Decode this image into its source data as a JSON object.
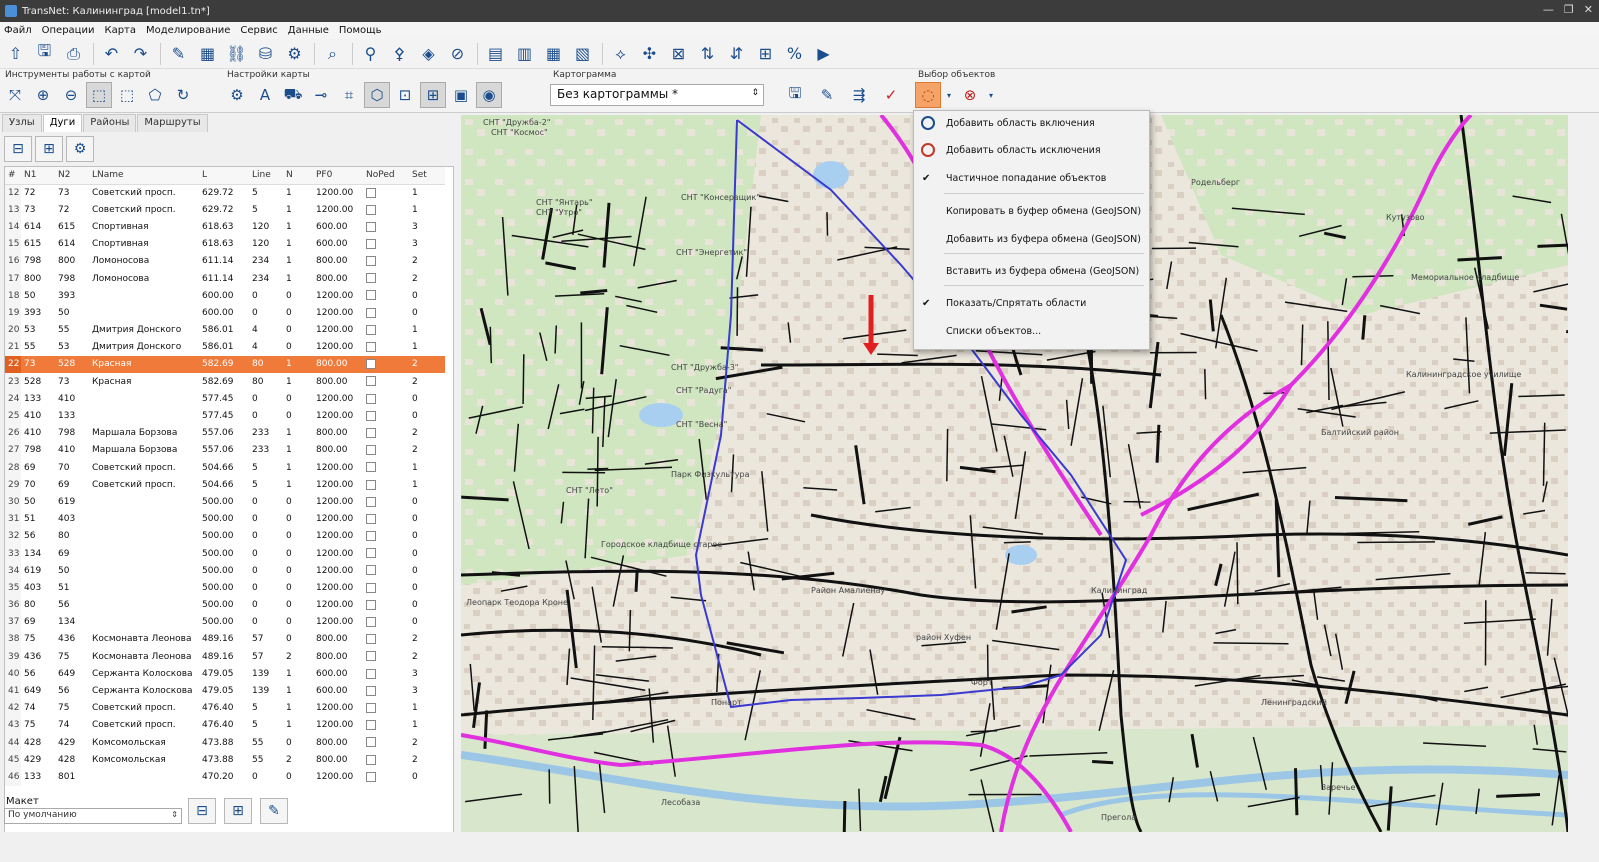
{
  "window": {
    "title": "TransNet: Калининград [model1.tn*]"
  },
  "menu": [
    "Файл",
    "Операции",
    "Карта",
    "Моделирование",
    "Сервис",
    "Данные",
    "Помощь"
  ],
  "groups": {
    "map_tools": "Инструменты работы с картой",
    "map_settings": "Настройки карты",
    "cartogram": "Картограмма",
    "object_select": "Выбор объектов"
  },
  "cartogram_select": {
    "value": "Без картограммы *"
  },
  "tabs": [
    "Узлы",
    "Дуги",
    "Районы",
    "Маршруты"
  ],
  "active_tab": "Дуги",
  "grid": {
    "headers": [
      "#",
      "N1",
      "N2",
      "LName",
      "L",
      "Line",
      "N",
      "PF0",
      "NoPed",
      "Set"
    ],
    "rows": [
      [
        "12",
        "72",
        "73",
        "Советский просп.",
        "629.72",
        "5",
        "1",
        "1200.00",
        "",
        "1"
      ],
      [
        "13",
        "73",
        "72",
        "Советский просп.",
        "629.72",
        "5",
        "1",
        "1200.00",
        "",
        "1"
      ],
      [
        "14",
        "614",
        "615",
        "Спортивная",
        "618.63",
        "120",
        "1",
        "600.00",
        "",
        "3"
      ],
      [
        "15",
        "615",
        "614",
        "Спортивная",
        "618.63",
        "120",
        "1",
        "600.00",
        "",
        "3"
      ],
      [
        "16",
        "798",
        "800",
        "Ломоносова",
        "611.14",
        "234",
        "1",
        "800.00",
        "",
        "2"
      ],
      [
        "17",
        "800",
        "798",
        "Ломоносова",
        "611.14",
        "234",
        "1",
        "800.00",
        "",
        "2"
      ],
      [
        "18",
        "50",
        "393",
        "",
        "600.00",
        "0",
        "0",
        "1200.00",
        "",
        "0"
      ],
      [
        "19",
        "393",
        "50",
        "",
        "600.00",
        "0",
        "0",
        "1200.00",
        "",
        "0"
      ],
      [
        "20",
        "53",
        "55",
        "Дмитрия Донского",
        "586.01",
        "4",
        "0",
        "1200.00",
        "",
        "1"
      ],
      [
        "21",
        "55",
        "53",
        "Дмитрия Донского",
        "586.01",
        "4",
        "0",
        "1200.00",
        "",
        "1"
      ],
      [
        "22",
        "73",
        "528",
        "Красная",
        "582.69",
        "80",
        "1",
        "800.00",
        "",
        "2"
      ],
      [
        "23",
        "528",
        "73",
        "Красная",
        "582.69",
        "80",
        "1",
        "800.00",
        "",
        "2"
      ],
      [
        "24",
        "133",
        "410",
        "",
        "577.45",
        "0",
        "0",
        "1200.00",
        "",
        "0"
      ],
      [
        "25",
        "410",
        "133",
        "",
        "577.45",
        "0",
        "0",
        "1200.00",
        "",
        "0"
      ],
      [
        "26",
        "410",
        "798",
        "Маршала Борзова",
        "557.06",
        "233",
        "1",
        "800.00",
        "",
        "2"
      ],
      [
        "27",
        "798",
        "410",
        "Маршала Борзова",
        "557.06",
        "233",
        "1",
        "800.00",
        "",
        "2"
      ],
      [
        "28",
        "69",
        "70",
        "Советский просп.",
        "504.66",
        "5",
        "1",
        "1200.00",
        "",
        "1"
      ],
      [
        "29",
        "70",
        "69",
        "Советский просп.",
        "504.66",
        "5",
        "1",
        "1200.00",
        "",
        "1"
      ],
      [
        "30",
        "50",
        "619",
        "",
        "500.00",
        "0",
        "0",
        "1200.00",
        "",
        "0"
      ],
      [
        "31",
        "51",
        "403",
        "",
        "500.00",
        "0",
        "0",
        "1200.00",
        "",
        "0"
      ],
      [
        "32",
        "56",
        "80",
        "",
        "500.00",
        "0",
        "0",
        "1200.00",
        "",
        "0"
      ],
      [
        "33",
        "134",
        "69",
        "",
        "500.00",
        "0",
        "0",
        "1200.00",
        "",
        "0"
      ],
      [
        "34",
        "619",
        "50",
        "",
        "500.00",
        "0",
        "0",
        "1200.00",
        "",
        "0"
      ],
      [
        "35",
        "403",
        "51",
        "",
        "500.00",
        "0",
        "0",
        "1200.00",
        "",
        "0"
      ],
      [
        "36",
        "80",
        "56",
        "",
        "500.00",
        "0",
        "0",
        "1200.00",
        "",
        "0"
      ],
      [
        "37",
        "69",
        "134",
        "",
        "500.00",
        "0",
        "0",
        "1200.00",
        "",
        "0"
      ],
      [
        "38",
        "75",
        "436",
        "Космонавта Леонова",
        "489.16",
        "57",
        "0",
        "800.00",
        "",
        "2"
      ],
      [
        "39",
        "436",
        "75",
        "Космонавта Леонова",
        "489.16",
        "57",
        "2",
        "800.00",
        "",
        "2"
      ],
      [
        "40",
        "56",
        "649",
        "Сержанта Колоскова",
        "479.05",
        "139",
        "1",
        "600.00",
        "",
        "3"
      ],
      [
        "41",
        "649",
        "56",
        "Сержанта Колоскова",
        "479.05",
        "139",
        "1",
        "600.00",
        "",
        "3"
      ],
      [
        "42",
        "74",
        "75",
        "Советский просп.",
        "476.40",
        "5",
        "1",
        "1200.00",
        "",
        "1"
      ],
      [
        "43",
        "75",
        "74",
        "Советский просп.",
        "476.40",
        "5",
        "1",
        "1200.00",
        "",
        "1"
      ],
      [
        "44",
        "428",
        "429",
        "Комсомольская",
        "473.88",
        "55",
        "0",
        "800.00",
        "",
        "2"
      ],
      [
        "45",
        "429",
        "428",
        "Комсомольская",
        "473.88",
        "55",
        "2",
        "800.00",
        "",
        "2"
      ],
      [
        "46",
        "133",
        "801",
        "",
        "470.20",
        "0",
        "0",
        "1200.00",
        "",
        "0"
      ]
    ],
    "selected_row": 10
  },
  "maket": {
    "label": "Макет",
    "value": "По умолчанию"
  },
  "context_menu": [
    {
      "label": "Добавить область включения",
      "icon": "include-area-icon"
    },
    {
      "label": "Добавить область исключения",
      "icon": "exclude-area-icon"
    },
    {
      "label": "Частичное попадание объектов",
      "checked": true
    },
    {
      "label": "Копировать в буфер обмена (GeoJSON)"
    },
    {
      "label": "Добавить из буфера обмена (GeoJSON)"
    },
    {
      "label": "Вставить из буфера обмена (GeoJSON)"
    },
    {
      "label": "Показать/Спрятать области",
      "checked": true
    },
    {
      "label": "Списки объектов..."
    }
  ],
  "map_labels": [
    "СНТ \"Дружба-2\"",
    "СНТ \"Космос\"",
    "СНТ \"Янтарь\"",
    "СНТ \"Утро\"",
    "СНТ \"Консервщик\"",
    "СНТ \"Энергетик\"",
    "СНТ \"Дружба-3\"",
    "СНТ \"Радуга\"",
    "СНТ \"Весна\"",
    "Парк Физкультура",
    "СНТ \"Лето\"",
    "Городское кладбище старое",
    "Леопарк Теодора Кроне",
    "Район Амалиенау",
    "район Хуфен",
    "Калининград",
    "Ленинградский",
    "Кутузово",
    "Родельберг",
    "Балтийский район",
    "Мемориальное кладбище",
    "Калининградское училище",
    "Заречье",
    "Прегола",
    "Лесобаза",
    "Форт",
    "Понарт"
  ],
  "colors": {
    "accent": "#f07a3a",
    "highlight_route": "#e030e0",
    "region_outline": "#3a3ad0"
  }
}
